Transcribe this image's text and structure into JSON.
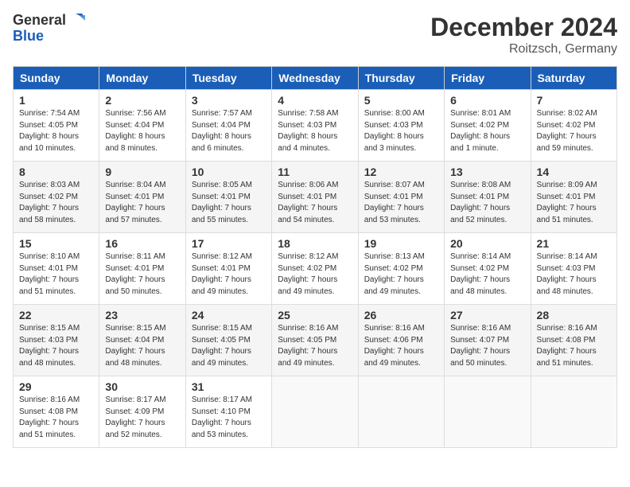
{
  "header": {
    "logo_general": "General",
    "logo_blue": "Blue",
    "title": "December 2024",
    "location": "Roitzsch, Germany"
  },
  "calendar": {
    "weekdays": [
      "Sunday",
      "Monday",
      "Tuesday",
      "Wednesday",
      "Thursday",
      "Friday",
      "Saturday"
    ],
    "weeks": [
      [
        {
          "day": "1",
          "info": "Sunrise: 7:54 AM\nSunset: 4:05 PM\nDaylight: 8 hours\nand 10 minutes."
        },
        {
          "day": "2",
          "info": "Sunrise: 7:56 AM\nSunset: 4:04 PM\nDaylight: 8 hours\nand 8 minutes."
        },
        {
          "day": "3",
          "info": "Sunrise: 7:57 AM\nSunset: 4:04 PM\nDaylight: 8 hours\nand 6 minutes."
        },
        {
          "day": "4",
          "info": "Sunrise: 7:58 AM\nSunset: 4:03 PM\nDaylight: 8 hours\nand 4 minutes."
        },
        {
          "day": "5",
          "info": "Sunrise: 8:00 AM\nSunset: 4:03 PM\nDaylight: 8 hours\nand 3 minutes."
        },
        {
          "day": "6",
          "info": "Sunrise: 8:01 AM\nSunset: 4:02 PM\nDaylight: 8 hours\nand 1 minute."
        },
        {
          "day": "7",
          "info": "Sunrise: 8:02 AM\nSunset: 4:02 PM\nDaylight: 7 hours\nand 59 minutes."
        }
      ],
      [
        {
          "day": "8",
          "info": "Sunrise: 8:03 AM\nSunset: 4:02 PM\nDaylight: 7 hours\nand 58 minutes."
        },
        {
          "day": "9",
          "info": "Sunrise: 8:04 AM\nSunset: 4:01 PM\nDaylight: 7 hours\nand 57 minutes."
        },
        {
          "day": "10",
          "info": "Sunrise: 8:05 AM\nSunset: 4:01 PM\nDaylight: 7 hours\nand 55 minutes."
        },
        {
          "day": "11",
          "info": "Sunrise: 8:06 AM\nSunset: 4:01 PM\nDaylight: 7 hours\nand 54 minutes."
        },
        {
          "day": "12",
          "info": "Sunrise: 8:07 AM\nSunset: 4:01 PM\nDaylight: 7 hours\nand 53 minutes."
        },
        {
          "day": "13",
          "info": "Sunrise: 8:08 AM\nSunset: 4:01 PM\nDaylight: 7 hours\nand 52 minutes."
        },
        {
          "day": "14",
          "info": "Sunrise: 8:09 AM\nSunset: 4:01 PM\nDaylight: 7 hours\nand 51 minutes."
        }
      ],
      [
        {
          "day": "15",
          "info": "Sunrise: 8:10 AM\nSunset: 4:01 PM\nDaylight: 7 hours\nand 51 minutes."
        },
        {
          "day": "16",
          "info": "Sunrise: 8:11 AM\nSunset: 4:01 PM\nDaylight: 7 hours\nand 50 minutes."
        },
        {
          "day": "17",
          "info": "Sunrise: 8:12 AM\nSunset: 4:01 PM\nDaylight: 7 hours\nand 49 minutes."
        },
        {
          "day": "18",
          "info": "Sunrise: 8:12 AM\nSunset: 4:02 PM\nDaylight: 7 hours\nand 49 minutes."
        },
        {
          "day": "19",
          "info": "Sunrise: 8:13 AM\nSunset: 4:02 PM\nDaylight: 7 hours\nand 49 minutes."
        },
        {
          "day": "20",
          "info": "Sunrise: 8:14 AM\nSunset: 4:02 PM\nDaylight: 7 hours\nand 48 minutes."
        },
        {
          "day": "21",
          "info": "Sunrise: 8:14 AM\nSunset: 4:03 PM\nDaylight: 7 hours\nand 48 minutes."
        }
      ],
      [
        {
          "day": "22",
          "info": "Sunrise: 8:15 AM\nSunset: 4:03 PM\nDaylight: 7 hours\nand 48 minutes."
        },
        {
          "day": "23",
          "info": "Sunrise: 8:15 AM\nSunset: 4:04 PM\nDaylight: 7 hours\nand 48 minutes."
        },
        {
          "day": "24",
          "info": "Sunrise: 8:15 AM\nSunset: 4:05 PM\nDaylight: 7 hours\nand 49 minutes."
        },
        {
          "day": "25",
          "info": "Sunrise: 8:16 AM\nSunset: 4:05 PM\nDaylight: 7 hours\nand 49 minutes."
        },
        {
          "day": "26",
          "info": "Sunrise: 8:16 AM\nSunset: 4:06 PM\nDaylight: 7 hours\nand 49 minutes."
        },
        {
          "day": "27",
          "info": "Sunrise: 8:16 AM\nSunset: 4:07 PM\nDaylight: 7 hours\nand 50 minutes."
        },
        {
          "day": "28",
          "info": "Sunrise: 8:16 AM\nSunset: 4:08 PM\nDaylight: 7 hours\nand 51 minutes."
        }
      ],
      [
        {
          "day": "29",
          "info": "Sunrise: 8:16 AM\nSunset: 4:08 PM\nDaylight: 7 hours\nand 51 minutes."
        },
        {
          "day": "30",
          "info": "Sunrise: 8:17 AM\nSunset: 4:09 PM\nDaylight: 7 hours\nand 52 minutes."
        },
        {
          "day": "31",
          "info": "Sunrise: 8:17 AM\nSunset: 4:10 PM\nDaylight: 7 hours\nand 53 minutes."
        },
        {
          "day": "",
          "info": ""
        },
        {
          "day": "",
          "info": ""
        },
        {
          "day": "",
          "info": ""
        },
        {
          "day": "",
          "info": ""
        }
      ]
    ]
  }
}
